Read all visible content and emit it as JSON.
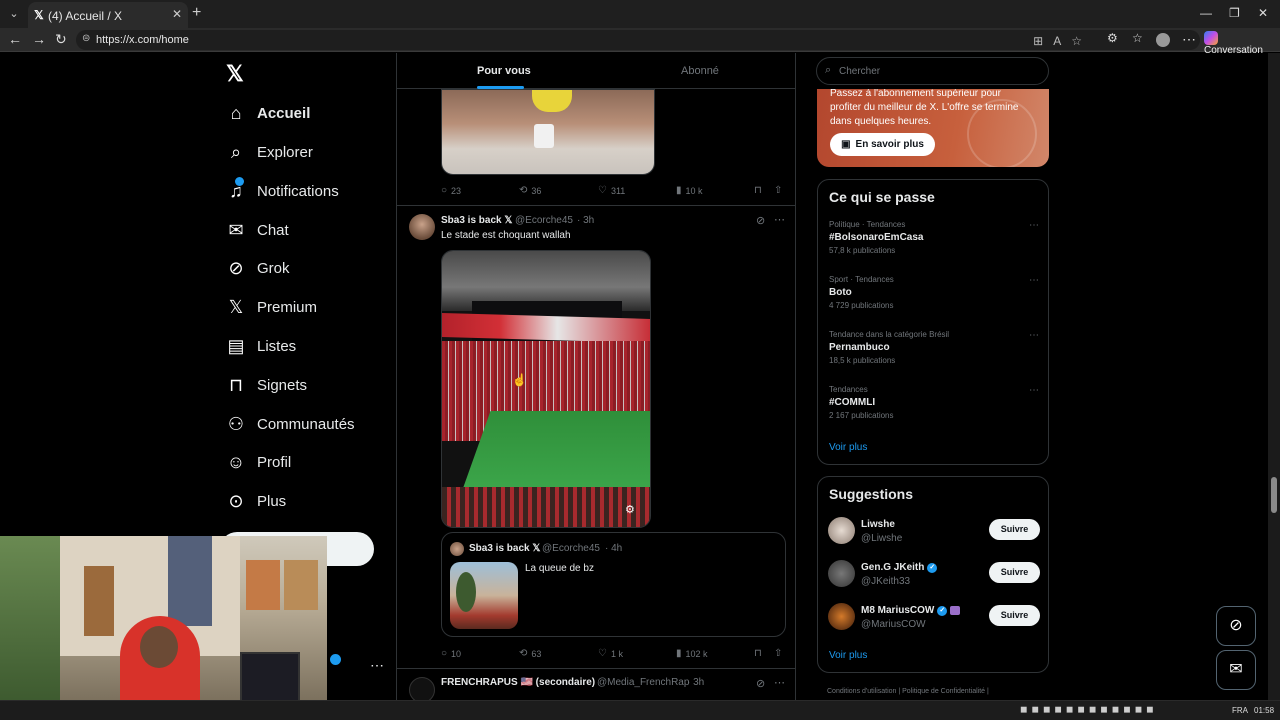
{
  "browser": {
    "tab_title": "(4) Accueil / X",
    "url": "https://x.com/home",
    "copilot_label": "Conversation"
  },
  "nav": {
    "items": [
      {
        "label": "Accueil",
        "icon": "home-icon",
        "active": true
      },
      {
        "label": "Explorer",
        "icon": "search-icon"
      },
      {
        "label": "Notifications",
        "icon": "bell-icon",
        "badge": "4"
      },
      {
        "label": "Chat",
        "icon": "mail-icon"
      },
      {
        "label": "Grok",
        "icon": "grok-icon"
      },
      {
        "label": "Premium",
        "icon": "x-icon"
      },
      {
        "label": "Listes",
        "icon": "list-icon"
      },
      {
        "label": "Signets",
        "icon": "bookmark-icon"
      },
      {
        "label": "Communautés",
        "icon": "communities-icon"
      },
      {
        "label": "Profil",
        "icon": "profile-icon"
      },
      {
        "label": "Plus",
        "icon": "more-icon"
      }
    ]
  },
  "feed": {
    "tabs": [
      "Pour vous",
      "Abonné"
    ],
    "tweet1_stats": {
      "replies": "23",
      "retweets": "36",
      "likes": "311",
      "views": "10 k"
    },
    "tweet2": {
      "name": "Sba3 is back 𝕏",
      "handle": "@Ecorche45",
      "time": "· 3h",
      "text": "Le stade est choquant wallah",
      "quote": {
        "name": "Sba3 is back 𝕏",
        "handle": "@Ecorche45",
        "time": "· 4h",
        "text": "La queue de bz"
      },
      "stats": {
        "replies": "10",
        "retweets": "63",
        "likes": "1 k",
        "views": "102 k"
      }
    },
    "tweet3": {
      "name": "FRENCHRAPUS 🇺🇸 (secondaire)",
      "handle": "@Media_FrenchRap",
      "time": "· 3h"
    }
  },
  "sidebar": {
    "search_placeholder": "Chercher",
    "promo_text": "Passez à l'abonnement supérieur pour profiter du meilleur de X. L'offre se termine dans quelques heures.",
    "promo_button": "En savoir plus",
    "trends_title": "Ce qui se passe",
    "trends": [
      {
        "meta": "Politique · Tendances",
        "name": "#BolsonaroEmCasa",
        "count": "57,8 k publications"
      },
      {
        "meta": "Sport · Tendances",
        "name": "Boto",
        "count": "4 729 publications"
      },
      {
        "meta": "Tendance dans la catégorie Brésil",
        "name": "Pernambuco",
        "count": "18,5 k publications"
      },
      {
        "meta": "Tendances",
        "name": "#COMMLI",
        "count": "2 167 publications"
      }
    ],
    "see_more": "Voir plus",
    "suggestions_title": "Suggestions",
    "suggestions": [
      {
        "name": "Liwshe",
        "handle": "@Liwshe",
        "verified": false
      },
      {
        "name": "Gen.G JKeith",
        "handle": "@JKeith33",
        "verified": true
      },
      {
        "name": "M8 MariusCOW",
        "handle": "@MariusCOW",
        "verified": true
      }
    ],
    "follow_label": "Suivre",
    "footer": "Conditions d'utilisation   |   Politique de Confidentialité   |"
  },
  "taskbar": {
    "lang": "FRA",
    "time": "01:58"
  }
}
